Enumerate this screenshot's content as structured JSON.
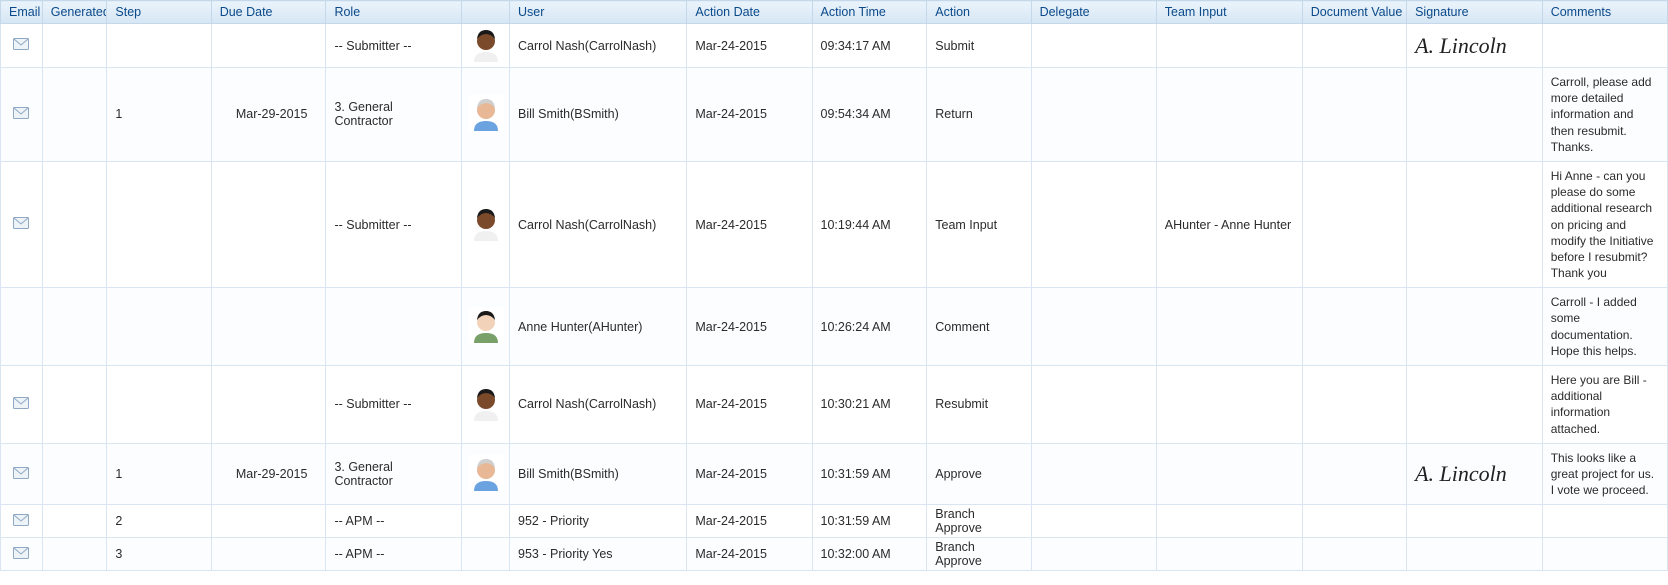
{
  "columns": {
    "email": "Email",
    "generated": "Generated",
    "step": "Step",
    "due_date": "Due Date",
    "role": "Role",
    "avatar": "",
    "user": "User",
    "action_date": "Action Date",
    "action_time": "Action Time",
    "action": "Action",
    "delegate": "Delegate",
    "team_input": "Team Input",
    "document_value": "Document Value",
    "signature": "Signature",
    "comments": "Comments"
  },
  "rows": [
    {
      "has_email": true,
      "generated": "",
      "step": "",
      "due_date": "",
      "role": "-- Submitter --",
      "avatar": "carrol",
      "user": "Carrol Nash(CarrolNash)",
      "action_date": "Mar-24-2015",
      "action_time": "09:34:17 AM",
      "action": "Submit",
      "delegate": "",
      "team_input": "",
      "document_value": "",
      "signature": "A. Lincoln",
      "comments": ""
    },
    {
      "has_email": true,
      "generated": "",
      "step": "1",
      "due_date": "Mar-29-2015",
      "role": "3. General Contractor",
      "avatar": "bill",
      "user": "Bill Smith(BSmith)",
      "action_date": "Mar-24-2015",
      "action_time": "09:54:34 AM",
      "action": "Return",
      "delegate": "",
      "team_input": "",
      "document_value": "",
      "signature": "",
      "comments": "Carroll, please add more detailed information and then resubmit. Thanks."
    },
    {
      "has_email": true,
      "generated": "",
      "step": "",
      "due_date": "",
      "role": "-- Submitter --",
      "avatar": "carrol",
      "user": "Carrol Nash(CarrolNash)",
      "action_date": "Mar-24-2015",
      "action_time": "10:19:44 AM",
      "action": "Team Input",
      "delegate": "",
      "team_input": "AHunter - Anne Hunter",
      "document_value": "",
      "signature": "",
      "comments": "Hi Anne - can you please do some additional research on pricing and modify the Initiative before I resubmit? Thank you"
    },
    {
      "has_email": false,
      "generated": "",
      "step": "",
      "due_date": "",
      "role": "",
      "avatar": "anne",
      "user": "Anne Hunter(AHunter)",
      "action_date": "Mar-24-2015",
      "action_time": "10:26:24 AM",
      "action": "Comment",
      "delegate": "",
      "team_input": "",
      "document_value": "",
      "signature": "",
      "comments": "Carroll - I added some documentation. Hope this helps."
    },
    {
      "has_email": true,
      "generated": "",
      "step": "",
      "due_date": "",
      "role": "-- Submitter --",
      "avatar": "carrol",
      "user": "Carrol Nash(CarrolNash)",
      "action_date": "Mar-24-2015",
      "action_time": "10:30:21 AM",
      "action": "Resubmit",
      "delegate": "",
      "team_input": "",
      "document_value": "",
      "signature": "",
      "comments": "Here you are Bill - additional information attached."
    },
    {
      "has_email": true,
      "generated": "",
      "step": "1",
      "due_date": "Mar-29-2015",
      "role": "3. General Contractor",
      "avatar": "bill",
      "user": "Bill Smith(BSmith)",
      "action_date": "Mar-24-2015",
      "action_time": "10:31:59 AM",
      "action": "Approve",
      "delegate": "",
      "team_input": "",
      "document_value": "",
      "signature": "A. Lincoln",
      "comments": "This looks like a great project for us. I vote we proceed."
    },
    {
      "has_email": true,
      "generated": "",
      "step": "2",
      "due_date": "",
      "role": "-- APM --",
      "avatar": "",
      "user": "952 - Priority",
      "action_date": "Mar-24-2015",
      "action_time": "10:31:59 AM",
      "action": "Branch Approve",
      "delegate": "",
      "team_input": "",
      "document_value": "",
      "signature": "",
      "comments": ""
    },
    {
      "has_email": true,
      "generated": "",
      "step": "3",
      "due_date": "",
      "role": "-- APM --",
      "avatar": "",
      "user": "953 - Priority Yes",
      "action_date": "Mar-24-2015",
      "action_time": "10:32:00 AM",
      "action": "Branch Approve",
      "delegate": "",
      "team_input": "",
      "document_value": "",
      "signature": "",
      "comments": ""
    }
  ],
  "avatars": {
    "carrol": {
      "skin": "#7a4a2a",
      "hair": "#1a1a1a",
      "shirt": "#f0f0f0"
    },
    "bill": {
      "skin": "#e8b896",
      "hair": "#cfcfcf",
      "shirt": "#6aa3e0"
    },
    "anne": {
      "skin": "#f2d2b8",
      "hair": "#1a1a1a",
      "shirt": "#7aa06a"
    }
  }
}
